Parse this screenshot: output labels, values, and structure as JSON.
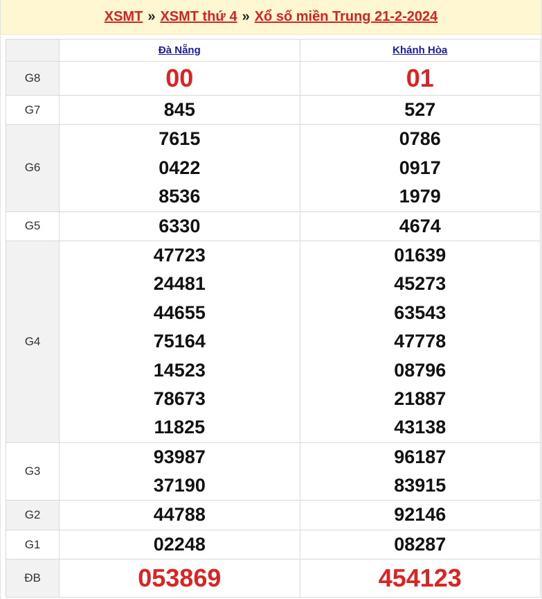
{
  "breadcrumb": {
    "items": [
      "XSMT",
      "XSMT thứ 4",
      "Xổ số miền Trung 21-2-2024"
    ],
    "separator": "»"
  },
  "table": {
    "provinces": [
      "Đà Nẵng",
      "Khánh Hòa"
    ],
    "prizes": [
      {
        "label": "G8",
        "da_nang": [
          "00"
        ],
        "khanh_hoa": [
          "01"
        ],
        "highlight": true
      },
      {
        "label": "G7",
        "da_nang": [
          "845"
        ],
        "khanh_hoa": [
          "527"
        ]
      },
      {
        "label": "G6",
        "da_nang": [
          "7615",
          "0422",
          "8536"
        ],
        "khanh_hoa": [
          "0786",
          "0917",
          "1979"
        ]
      },
      {
        "label": "G5",
        "da_nang": [
          "6330"
        ],
        "khanh_hoa": [
          "4674"
        ]
      },
      {
        "label": "G4",
        "da_nang": [
          "47723",
          "24481",
          "44655",
          "75164",
          "14523",
          "78673",
          "11825"
        ],
        "khanh_hoa": [
          "01639",
          "45273",
          "63543",
          "47778",
          "08796",
          "21887",
          "43138"
        ]
      },
      {
        "label": "G3",
        "da_nang": [
          "93987",
          "37190"
        ],
        "khanh_hoa": [
          "96187",
          "83915"
        ]
      },
      {
        "label": "G2",
        "da_nang": [
          "44788"
        ],
        "khanh_hoa": [
          "92146"
        ]
      },
      {
        "label": "G1",
        "da_nang": [
          "02248"
        ],
        "khanh_hoa": [
          "08287"
        ]
      },
      {
        "label": "ĐB",
        "da_nang": [
          "053869"
        ],
        "khanh_hoa": [
          "454123"
        ],
        "highlight": true
      }
    ]
  },
  "colors": {
    "header_bg": "#fff7d1",
    "link_red": "#d32222",
    "link_blue": "#1a1aa6",
    "number_red": "#dd2222",
    "label_bg_alt": "#f2f2f2"
  }
}
